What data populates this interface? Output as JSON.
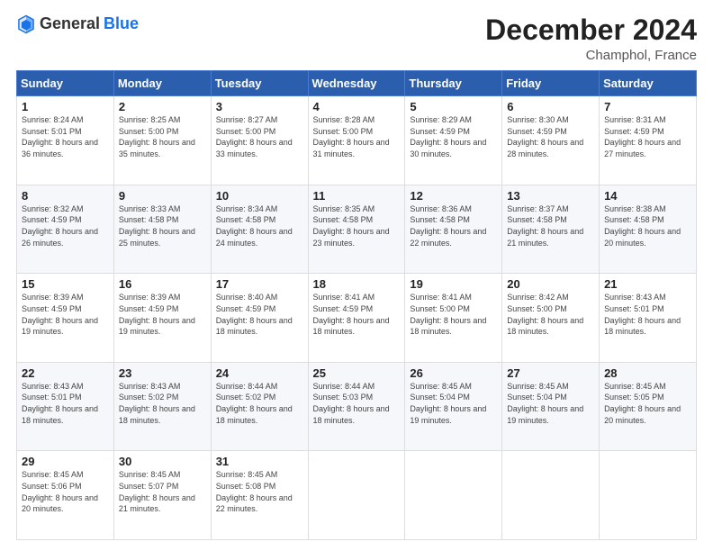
{
  "header": {
    "logo_general": "General",
    "logo_blue": "Blue",
    "month": "December 2024",
    "location": "Champhol, France"
  },
  "days_of_week": [
    "Sunday",
    "Monday",
    "Tuesday",
    "Wednesday",
    "Thursday",
    "Friday",
    "Saturday"
  ],
  "weeks": [
    [
      {
        "day": "1",
        "sunrise": "Sunrise: 8:24 AM",
        "sunset": "Sunset: 5:01 PM",
        "daylight": "Daylight: 8 hours and 36 minutes."
      },
      {
        "day": "2",
        "sunrise": "Sunrise: 8:25 AM",
        "sunset": "Sunset: 5:00 PM",
        "daylight": "Daylight: 8 hours and 35 minutes."
      },
      {
        "day": "3",
        "sunrise": "Sunrise: 8:27 AM",
        "sunset": "Sunset: 5:00 PM",
        "daylight": "Daylight: 8 hours and 33 minutes."
      },
      {
        "day": "4",
        "sunrise": "Sunrise: 8:28 AM",
        "sunset": "Sunset: 5:00 PM",
        "daylight": "Daylight: 8 hours and 31 minutes."
      },
      {
        "day": "5",
        "sunrise": "Sunrise: 8:29 AM",
        "sunset": "Sunset: 4:59 PM",
        "daylight": "Daylight: 8 hours and 30 minutes."
      },
      {
        "day": "6",
        "sunrise": "Sunrise: 8:30 AM",
        "sunset": "Sunset: 4:59 PM",
        "daylight": "Daylight: 8 hours and 28 minutes."
      },
      {
        "day": "7",
        "sunrise": "Sunrise: 8:31 AM",
        "sunset": "Sunset: 4:59 PM",
        "daylight": "Daylight: 8 hours and 27 minutes."
      }
    ],
    [
      {
        "day": "8",
        "sunrise": "Sunrise: 8:32 AM",
        "sunset": "Sunset: 4:59 PM",
        "daylight": "Daylight: 8 hours and 26 minutes."
      },
      {
        "day": "9",
        "sunrise": "Sunrise: 8:33 AM",
        "sunset": "Sunset: 4:58 PM",
        "daylight": "Daylight: 8 hours and 25 minutes."
      },
      {
        "day": "10",
        "sunrise": "Sunrise: 8:34 AM",
        "sunset": "Sunset: 4:58 PM",
        "daylight": "Daylight: 8 hours and 24 minutes."
      },
      {
        "day": "11",
        "sunrise": "Sunrise: 8:35 AM",
        "sunset": "Sunset: 4:58 PM",
        "daylight": "Daylight: 8 hours and 23 minutes."
      },
      {
        "day": "12",
        "sunrise": "Sunrise: 8:36 AM",
        "sunset": "Sunset: 4:58 PM",
        "daylight": "Daylight: 8 hours and 22 minutes."
      },
      {
        "day": "13",
        "sunrise": "Sunrise: 8:37 AM",
        "sunset": "Sunset: 4:58 PM",
        "daylight": "Daylight: 8 hours and 21 minutes."
      },
      {
        "day": "14",
        "sunrise": "Sunrise: 8:38 AM",
        "sunset": "Sunset: 4:58 PM",
        "daylight": "Daylight: 8 hours and 20 minutes."
      }
    ],
    [
      {
        "day": "15",
        "sunrise": "Sunrise: 8:39 AM",
        "sunset": "Sunset: 4:59 PM",
        "daylight": "Daylight: 8 hours and 19 minutes."
      },
      {
        "day": "16",
        "sunrise": "Sunrise: 8:39 AM",
        "sunset": "Sunset: 4:59 PM",
        "daylight": "Daylight: 8 hours and 19 minutes."
      },
      {
        "day": "17",
        "sunrise": "Sunrise: 8:40 AM",
        "sunset": "Sunset: 4:59 PM",
        "daylight": "Daylight: 8 hours and 18 minutes."
      },
      {
        "day": "18",
        "sunrise": "Sunrise: 8:41 AM",
        "sunset": "Sunset: 4:59 PM",
        "daylight": "Daylight: 8 hours and 18 minutes."
      },
      {
        "day": "19",
        "sunrise": "Sunrise: 8:41 AM",
        "sunset": "Sunset: 5:00 PM",
        "daylight": "Daylight: 8 hours and 18 minutes."
      },
      {
        "day": "20",
        "sunrise": "Sunrise: 8:42 AM",
        "sunset": "Sunset: 5:00 PM",
        "daylight": "Daylight: 8 hours and 18 minutes."
      },
      {
        "day": "21",
        "sunrise": "Sunrise: 8:43 AM",
        "sunset": "Sunset: 5:01 PM",
        "daylight": "Daylight: 8 hours and 18 minutes."
      }
    ],
    [
      {
        "day": "22",
        "sunrise": "Sunrise: 8:43 AM",
        "sunset": "Sunset: 5:01 PM",
        "daylight": "Daylight: 8 hours and 18 minutes."
      },
      {
        "day": "23",
        "sunrise": "Sunrise: 8:43 AM",
        "sunset": "Sunset: 5:02 PM",
        "daylight": "Daylight: 8 hours and 18 minutes."
      },
      {
        "day": "24",
        "sunrise": "Sunrise: 8:44 AM",
        "sunset": "Sunset: 5:02 PM",
        "daylight": "Daylight: 8 hours and 18 minutes."
      },
      {
        "day": "25",
        "sunrise": "Sunrise: 8:44 AM",
        "sunset": "Sunset: 5:03 PM",
        "daylight": "Daylight: 8 hours and 18 minutes."
      },
      {
        "day": "26",
        "sunrise": "Sunrise: 8:45 AM",
        "sunset": "Sunset: 5:04 PM",
        "daylight": "Daylight: 8 hours and 19 minutes."
      },
      {
        "day": "27",
        "sunrise": "Sunrise: 8:45 AM",
        "sunset": "Sunset: 5:04 PM",
        "daylight": "Daylight: 8 hours and 19 minutes."
      },
      {
        "day": "28",
        "sunrise": "Sunrise: 8:45 AM",
        "sunset": "Sunset: 5:05 PM",
        "daylight": "Daylight: 8 hours and 20 minutes."
      }
    ],
    [
      {
        "day": "29",
        "sunrise": "Sunrise: 8:45 AM",
        "sunset": "Sunset: 5:06 PM",
        "daylight": "Daylight: 8 hours and 20 minutes."
      },
      {
        "day": "30",
        "sunrise": "Sunrise: 8:45 AM",
        "sunset": "Sunset: 5:07 PM",
        "daylight": "Daylight: 8 hours and 21 minutes."
      },
      {
        "day": "31",
        "sunrise": "Sunrise: 8:45 AM",
        "sunset": "Sunset: 5:08 PM",
        "daylight": "Daylight: 8 hours and 22 minutes."
      },
      null,
      null,
      null,
      null
    ]
  ]
}
